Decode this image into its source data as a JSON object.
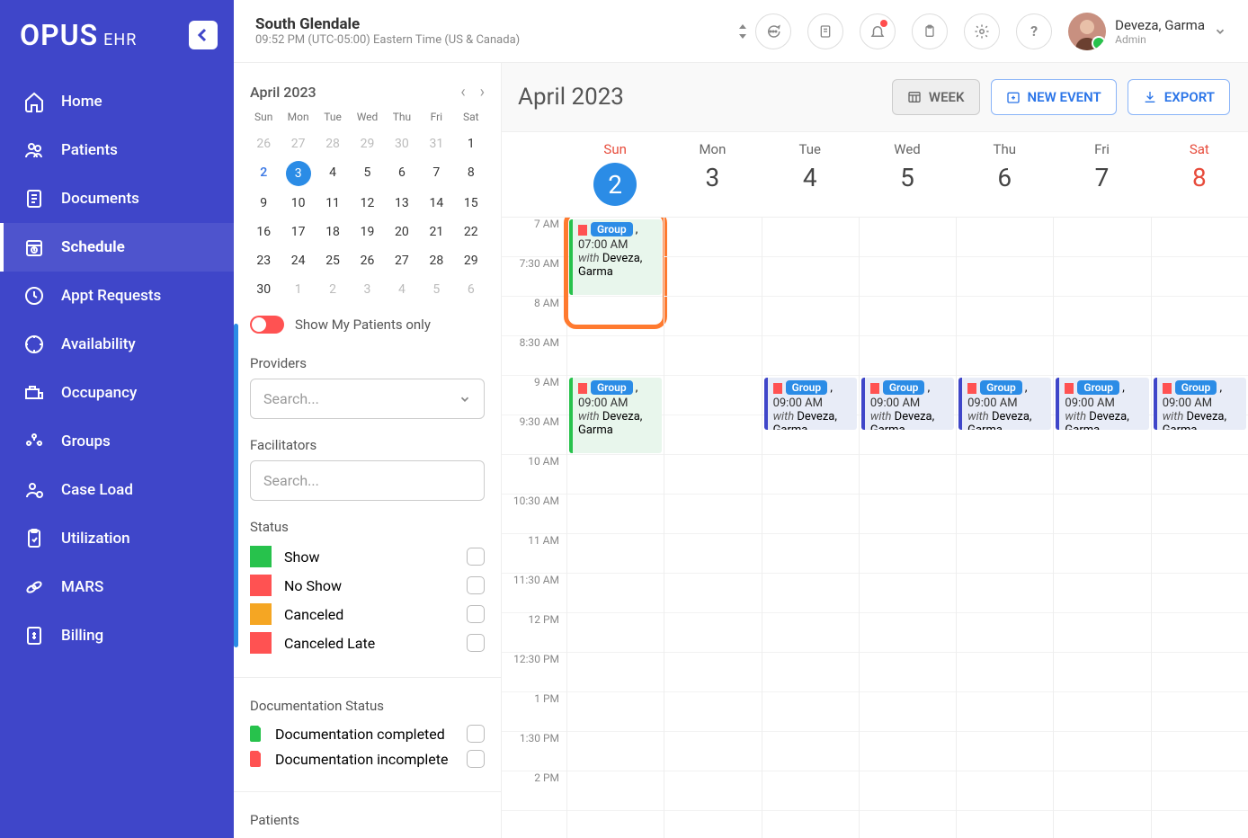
{
  "brand": {
    "name": "OPUS",
    "sub": "EHR"
  },
  "header": {
    "location": "South Glendale",
    "datetime": "09:52 PM (UTC-05:00) Eastern Time (US & Canada)",
    "user_name": "Deveza, Garma",
    "user_role": "Admin"
  },
  "nav": [
    {
      "key": "home",
      "label": "Home"
    },
    {
      "key": "patients",
      "label": "Patients"
    },
    {
      "key": "documents",
      "label": "Documents"
    },
    {
      "key": "schedule",
      "label": "Schedule",
      "active": true
    },
    {
      "key": "appt-requests",
      "label": "Appt Requests"
    },
    {
      "key": "availability",
      "label": "Availability"
    },
    {
      "key": "occupancy",
      "label": "Occupancy"
    },
    {
      "key": "groups",
      "label": "Groups"
    },
    {
      "key": "case-load",
      "label": "Case Load"
    },
    {
      "key": "utilization",
      "label": "Utilization"
    },
    {
      "key": "mars",
      "label": "MARS"
    },
    {
      "key": "billing",
      "label": "Billing"
    }
  ],
  "minical": {
    "title": "April 2023",
    "dow": [
      "Sun",
      "Mon",
      "Tue",
      "Wed",
      "Thu",
      "Fri",
      "Sat"
    ],
    "days": [
      {
        "n": "26",
        "m": true
      },
      {
        "n": "27",
        "m": true
      },
      {
        "n": "28",
        "m": true
      },
      {
        "n": "29",
        "m": true
      },
      {
        "n": "30",
        "m": true
      },
      {
        "n": "31",
        "m": true
      },
      {
        "n": "1"
      },
      {
        "n": "2",
        "today": true
      },
      {
        "n": "3",
        "sel": true
      },
      {
        "n": "4"
      },
      {
        "n": "5"
      },
      {
        "n": "6"
      },
      {
        "n": "7"
      },
      {
        "n": "8"
      },
      {
        "n": "9"
      },
      {
        "n": "10"
      },
      {
        "n": "11"
      },
      {
        "n": "12"
      },
      {
        "n": "13"
      },
      {
        "n": "14"
      },
      {
        "n": "15"
      },
      {
        "n": "16"
      },
      {
        "n": "17"
      },
      {
        "n": "18"
      },
      {
        "n": "19"
      },
      {
        "n": "20"
      },
      {
        "n": "21"
      },
      {
        "n": "22"
      },
      {
        "n": "23"
      },
      {
        "n": "24"
      },
      {
        "n": "25"
      },
      {
        "n": "26"
      },
      {
        "n": "27"
      },
      {
        "n": "28"
      },
      {
        "n": "29"
      },
      {
        "n": "30"
      },
      {
        "n": "1",
        "m": true
      },
      {
        "n": "2",
        "m": true
      },
      {
        "n": "3",
        "m": true
      },
      {
        "n": "4",
        "m": true
      },
      {
        "n": "5",
        "m": true
      },
      {
        "n": "6",
        "m": true
      }
    ]
  },
  "filters": {
    "show_my_patients_label": "Show My Patients only",
    "providers_label": "Providers",
    "providers_placeholder": "Search...",
    "facilitators_label": "Facilitators",
    "facilitators_placeholder": "Search...",
    "status_label": "Status",
    "statuses": [
      {
        "label": "Show",
        "color": "#27c24c"
      },
      {
        "label": "No Show",
        "color": "#ff5252"
      },
      {
        "label": "Canceled",
        "color": "#f5a623"
      },
      {
        "label": "Canceled Late",
        "color": "#ff5252"
      }
    ],
    "doc_status_label": "Documentation Status",
    "doc_statuses": [
      {
        "label": "Documentation completed",
        "color": "#27c24c"
      },
      {
        "label": "Documentation incomplete",
        "color": "#ff5252"
      }
    ],
    "patients_label": "Patients"
  },
  "calendar": {
    "title": "April 2023",
    "view_label": "WEEK",
    "new_event_label": "NEW EVENT",
    "export_label": "EXPORT",
    "dow": [
      {
        "name": "Sun",
        "num": "2",
        "weekend": true,
        "today": true
      },
      {
        "name": "Mon",
        "num": "3"
      },
      {
        "name": "Tue",
        "num": "4"
      },
      {
        "name": "Wed",
        "num": "5"
      },
      {
        "name": "Thu",
        "num": "6"
      },
      {
        "name": "Fri",
        "num": "7"
      },
      {
        "name": "Sat",
        "num": "8",
        "weekend": true
      }
    ],
    "time_slots": [
      "7 AM",
      "7:30 AM",
      "8 AM",
      "8:30 AM",
      "9 AM",
      "9:30 AM",
      "10 AM",
      "10:30 AM",
      "11 AM",
      "11:30 AM",
      "12 PM",
      "12:30 PM",
      "1 PM",
      "1:30 PM",
      "2 PM"
    ],
    "events": [
      {
        "day": 0,
        "slot": 0,
        "span": 2,
        "style": "green",
        "badge": "Group",
        "time": "07:00 AM",
        "with": "with",
        "who": "Deveza, Garma",
        "highlight": true
      },
      {
        "day": 0,
        "slot": 4,
        "span": 2,
        "style": "green",
        "badge": "Group",
        "time": "09:00 AM",
        "with": "with",
        "who": "Deveza, Garma"
      },
      {
        "day": 2,
        "slot": 4,
        "span": 1.4,
        "style": "blue",
        "badge": "Group",
        "time": "09:00 AM",
        "with": "with",
        "who": "Deveza, Garma"
      },
      {
        "day": 3,
        "slot": 4,
        "span": 1.4,
        "style": "blue",
        "badge": "Group",
        "time": "09:00 AM",
        "with": "with",
        "who": "Deveza, Garma"
      },
      {
        "day": 4,
        "slot": 4,
        "span": 1.4,
        "style": "blue",
        "badge": "Group",
        "time": "09:00 AM",
        "with": "with",
        "who": "Deveza, Garma"
      },
      {
        "day": 5,
        "slot": 4,
        "span": 1.4,
        "style": "blue",
        "badge": "Group",
        "time": "09:00 AM",
        "with": "with",
        "who": "Deveza, Garma"
      },
      {
        "day": 6,
        "slot": 4,
        "span": 1.4,
        "style": "blue",
        "badge": "Group",
        "time": "09:00 AM",
        "with": "with",
        "who": "Deveza, Garma"
      }
    ]
  }
}
